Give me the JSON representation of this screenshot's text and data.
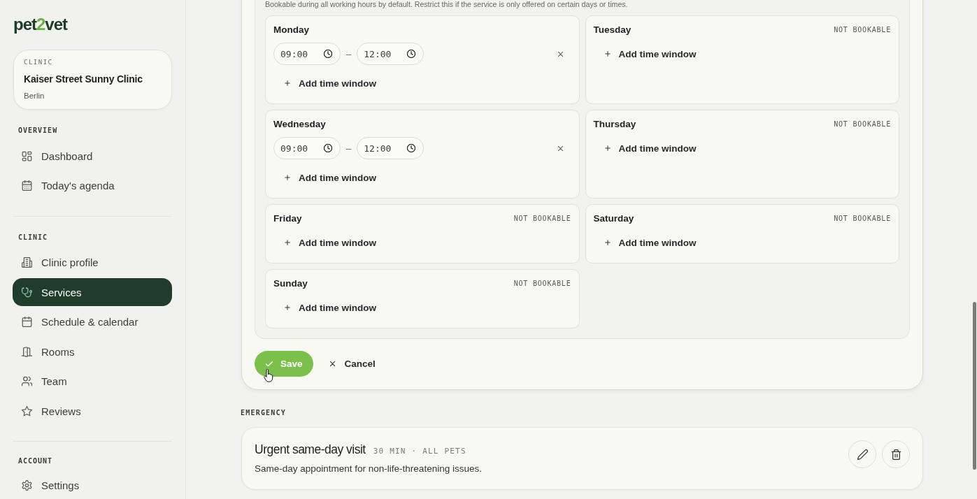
{
  "sidebar": {
    "logo": {
      "before": "pet",
      "accent": "2",
      "after": "vet"
    },
    "clinic": {
      "label": "CLINIC",
      "name": "Kaiser Street Sunny Clinic",
      "city": "Berlin"
    },
    "sections": [
      {
        "title": "OVERVIEW",
        "items": [
          {
            "label": "Dashboard",
            "selected": false
          },
          {
            "label": "Today's agenda",
            "selected": false
          }
        ]
      },
      {
        "title": "CLINIC",
        "items": [
          {
            "label": "Clinic profile",
            "selected": false
          },
          {
            "label": "Services",
            "selected": true
          },
          {
            "label": "Schedule & calendar",
            "selected": false
          },
          {
            "label": "Rooms",
            "selected": false
          },
          {
            "label": "Team",
            "selected": false
          },
          {
            "label": "Reviews",
            "selected": false
          }
        ]
      },
      {
        "title": "ACCOUNT",
        "items": [
          {
            "label": "Settings",
            "selected": false
          }
        ]
      }
    ]
  },
  "availability": {
    "hint": "Bookable during all working hours by default. Restrict this if the service is only offered on certain days or times.",
    "days": [
      {
        "name": "Monday",
        "windows": [
          {
            "start": "09:00",
            "separator": "–",
            "end": "12:00"
          }
        ],
        "add_label": "Add time window"
      },
      {
        "name": "Tuesday",
        "status": "NOT BOOKABLE",
        "add_label": "Add time window"
      },
      {
        "name": "Wednesday",
        "windows": [
          {
            "start": "09:00",
            "separator": "–",
            "end": "12:00"
          }
        ],
        "add_label": "Add time window"
      },
      {
        "name": "Thursday",
        "status": "NOT BOOKABLE",
        "add_label": "Add time window"
      },
      {
        "name": "Friday",
        "status": "NOT BOOKABLE",
        "add_label": "Add time window"
      },
      {
        "name": "Saturday",
        "status": "NOT BOOKABLE",
        "add_label": "Add time window"
      },
      {
        "name": "Sunday",
        "status": "NOT BOOKABLE",
        "add_label": "Add time window"
      }
    ],
    "actions": [
      {
        "kind": "save",
        "label": "Save"
      },
      {
        "kind": "cancel",
        "label": "Cancel"
      }
    ]
  },
  "emergency": {
    "title": "EMERGENCY",
    "services": [
      {
        "title": "Urgent same-day visit",
        "meta": "30 MIN · ALL PETS",
        "description": "Same-day appointment for non-life-threatening issues.",
        "actions": [
          {
            "kind": "edit"
          },
          {
            "kind": "delete"
          }
        ]
      }
    ]
  }
}
